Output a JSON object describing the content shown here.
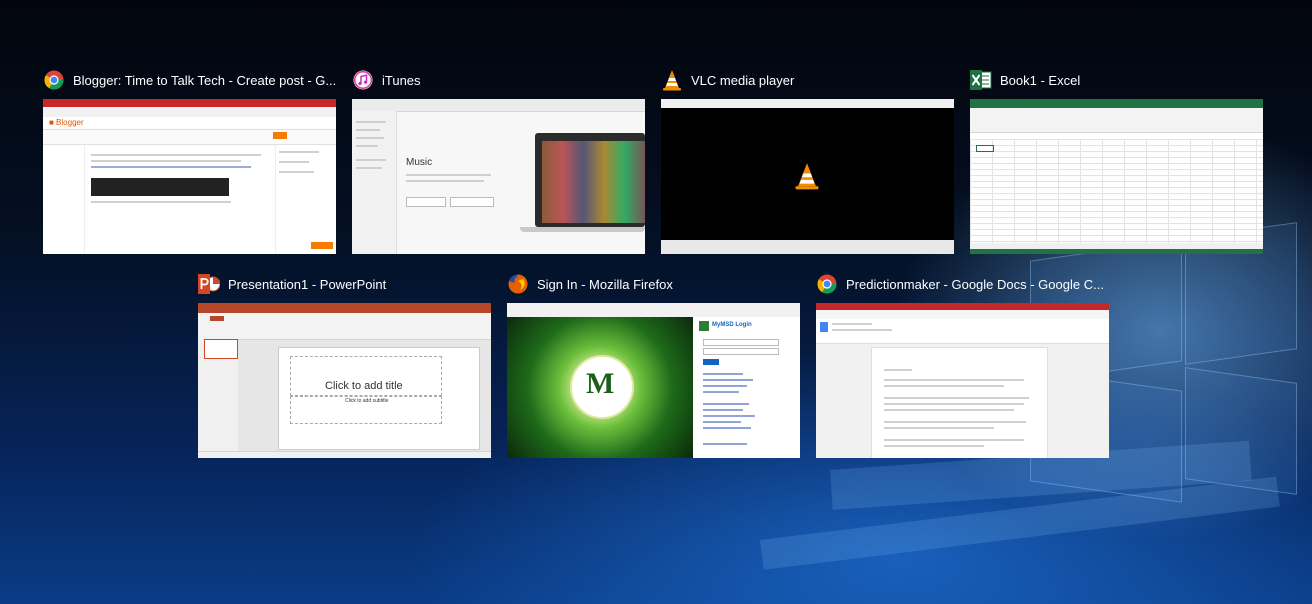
{
  "task_view": {
    "windows": [
      {
        "title": "Blogger: Time to Talk Tech - Create post - G...",
        "icon": "chrome-icon"
      },
      {
        "title": "iTunes",
        "icon": "itunes-icon",
        "preview": {
          "heading": "Music"
        }
      },
      {
        "title": "VLC media player",
        "icon": "vlc-icon"
      },
      {
        "title": "Book1 - Excel",
        "icon": "excel-icon"
      },
      {
        "title": "Presentation1 - PowerPoint",
        "icon": "powerpoint-icon",
        "preview": {
          "placeholder_title": "Click to add title",
          "placeholder_subtitle": "Click to add subtitle"
        }
      },
      {
        "title": "Sign In - Mozilla Firefox",
        "icon": "firefox-icon",
        "preview": {
          "login_heading": "MyMSD Login",
          "emblem_letter": "M"
        }
      },
      {
        "title": "Predictionmaker - Google Docs - Google C...",
        "icon": "chrome-icon"
      }
    ]
  }
}
